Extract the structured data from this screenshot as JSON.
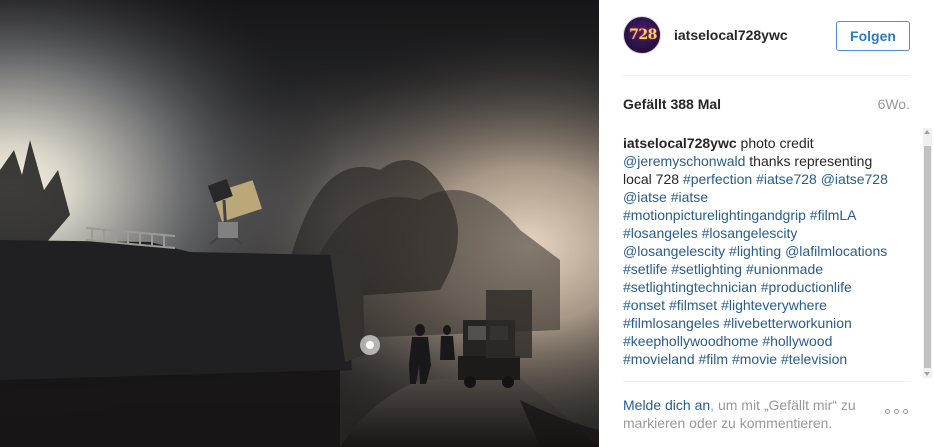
{
  "post": {
    "image_alt": "",
    "username": "iatselocal728ywc",
    "avatar_text": "728",
    "follow_label": "Folgen",
    "likes": "Gefällt 388 Mal",
    "time": "6Wo.",
    "caption": {
      "author": "iatselocal728ywc",
      "segments": [
        {
          "type": "text",
          "value": " photo credit "
        },
        {
          "type": "tag",
          "value": "@jeremyschonwald"
        },
        {
          "type": "text",
          "value": " thanks representing local 728 "
        },
        {
          "type": "tag",
          "value": "#perfection"
        },
        {
          "type": "text",
          "value": " "
        },
        {
          "type": "tag",
          "value": "#iatse728"
        },
        {
          "type": "text",
          "value": " "
        },
        {
          "type": "tag",
          "value": "@iatse728"
        },
        {
          "type": "text",
          "value": " "
        },
        {
          "type": "tag",
          "value": "@iatse"
        },
        {
          "type": "text",
          "value": " "
        },
        {
          "type": "tag",
          "value": "#iatse"
        },
        {
          "type": "text",
          "value": " "
        },
        {
          "type": "tag",
          "value": "#motionpicturelightingandgrip"
        },
        {
          "type": "text",
          "value": " "
        },
        {
          "type": "tag",
          "value": "#filmLA"
        },
        {
          "type": "text",
          "value": " "
        },
        {
          "type": "tag",
          "value": "#losangeles"
        },
        {
          "type": "text",
          "value": " "
        },
        {
          "type": "tag",
          "value": "#losangelescity"
        },
        {
          "type": "text",
          "value": " "
        },
        {
          "type": "tag",
          "value": "@losangelescity"
        },
        {
          "type": "text",
          "value": " "
        },
        {
          "type": "tag",
          "value": "#lighting"
        },
        {
          "type": "text",
          "value": " "
        },
        {
          "type": "tag",
          "value": "@lafilmlocations"
        },
        {
          "type": "text",
          "value": " "
        },
        {
          "type": "tag",
          "value": "#setlife"
        },
        {
          "type": "text",
          "value": " "
        },
        {
          "type": "tag",
          "value": "#setlighting"
        },
        {
          "type": "text",
          "value": " "
        },
        {
          "type": "tag",
          "value": "#unionmade"
        },
        {
          "type": "text",
          "value": " "
        },
        {
          "type": "tag",
          "value": "#setlightingtechnician"
        },
        {
          "type": "text",
          "value": " "
        },
        {
          "type": "tag",
          "value": "#productionlife"
        },
        {
          "type": "text",
          "value": " "
        },
        {
          "type": "tag",
          "value": "#onset"
        },
        {
          "type": "text",
          "value": " "
        },
        {
          "type": "tag",
          "value": "#filmset"
        },
        {
          "type": "text",
          "value": " "
        },
        {
          "type": "tag",
          "value": "#lighteverywhere"
        },
        {
          "type": "text",
          "value": " "
        },
        {
          "type": "tag",
          "value": "#filmlosangeles"
        },
        {
          "type": "text",
          "value": " "
        },
        {
          "type": "tag",
          "value": "#livebetterworkunion"
        },
        {
          "type": "text",
          "value": " "
        },
        {
          "type": "tag",
          "value": "#keephollywoodhome"
        },
        {
          "type": "text",
          "value": " "
        },
        {
          "type": "tag",
          "value": "#hollywood"
        },
        {
          "type": "text",
          "value": " "
        },
        {
          "type": "tag",
          "value": "#movieland"
        },
        {
          "type": "text",
          "value": " "
        },
        {
          "type": "tag",
          "value": "#film"
        },
        {
          "type": "text",
          "value": " "
        },
        {
          "type": "tag",
          "value": "#movie"
        },
        {
          "type": "text",
          "value": " "
        },
        {
          "type": "tag",
          "value": "#television"
        }
      ]
    }
  },
  "footer": {
    "login_link": "Melde dich an",
    "login_rest": ", um mit „Gefällt mir“ zu markieren oder zu kommentieren.",
    "more_icon": "more-dots-icon"
  },
  "colors": {
    "link": "#275d91",
    "follow": "#2c7bc0",
    "muted": "#999999"
  }
}
